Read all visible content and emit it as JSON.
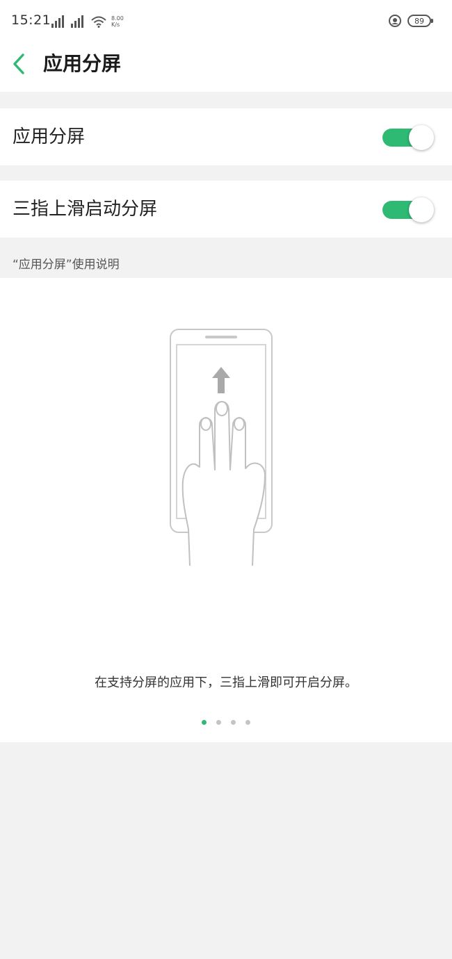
{
  "status_bar": {
    "time": "15:21",
    "network_speed": "8.00 K/s",
    "battery_level": "89"
  },
  "header": {
    "title": "应用分屏",
    "back_icon": "chevron-left-icon"
  },
  "settings": [
    {
      "label": "应用分屏",
      "enabled": true
    },
    {
      "label": "三指上滑启动分屏",
      "enabled": true
    }
  ],
  "guide": {
    "section_title": "“应用分屏”使用说明",
    "illustration_icon": "three-finger-swipe-up-icon",
    "caption": "在支持分屏的应用下，三指上滑即可开启分屏。",
    "page_count": 4,
    "current_page": 1
  },
  "colors": {
    "accent": "#2fba74",
    "background_gray": "#f2f2f2",
    "text_primary": "#222222",
    "text_secondary": "#555555"
  }
}
